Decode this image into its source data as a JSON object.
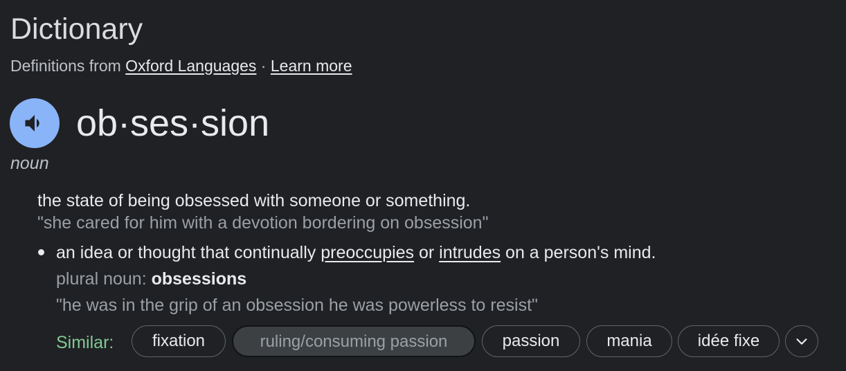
{
  "header": {
    "title": "Dictionary",
    "source_prefix": "Definitions from ",
    "source_link": "Oxford Languages",
    "separator": " · ",
    "learn_more": "Learn more"
  },
  "entry": {
    "headword": "ob·ses·sion",
    "part_of_speech": "noun",
    "senses": [
      {
        "definition": "the state of being obsessed with someone or something.",
        "example": "\"she cared for him with a devotion bordering on obsession\""
      },
      {
        "definition_parts": [
          "an idea or thought that continually ",
          "preoccupies",
          " or ",
          "intrudes",
          " on a person's mind."
        ],
        "plural_label": "plural noun: ",
        "plural_form": "obsessions",
        "example": "\"he was in the grip of an obsession he was powerless to resist\""
      }
    ]
  },
  "similar": {
    "label": "Similar:",
    "chips": [
      "fixation",
      "ruling/consuming passion",
      "passion",
      "mania",
      "idée fixe"
    ],
    "active_index": 1
  },
  "icons": {
    "speaker": "speaker-icon",
    "more": "chevron-down-icon"
  },
  "colors": {
    "background": "#202124",
    "speaker_button": "#8ab4f8",
    "similar_label": "#81c995"
  }
}
